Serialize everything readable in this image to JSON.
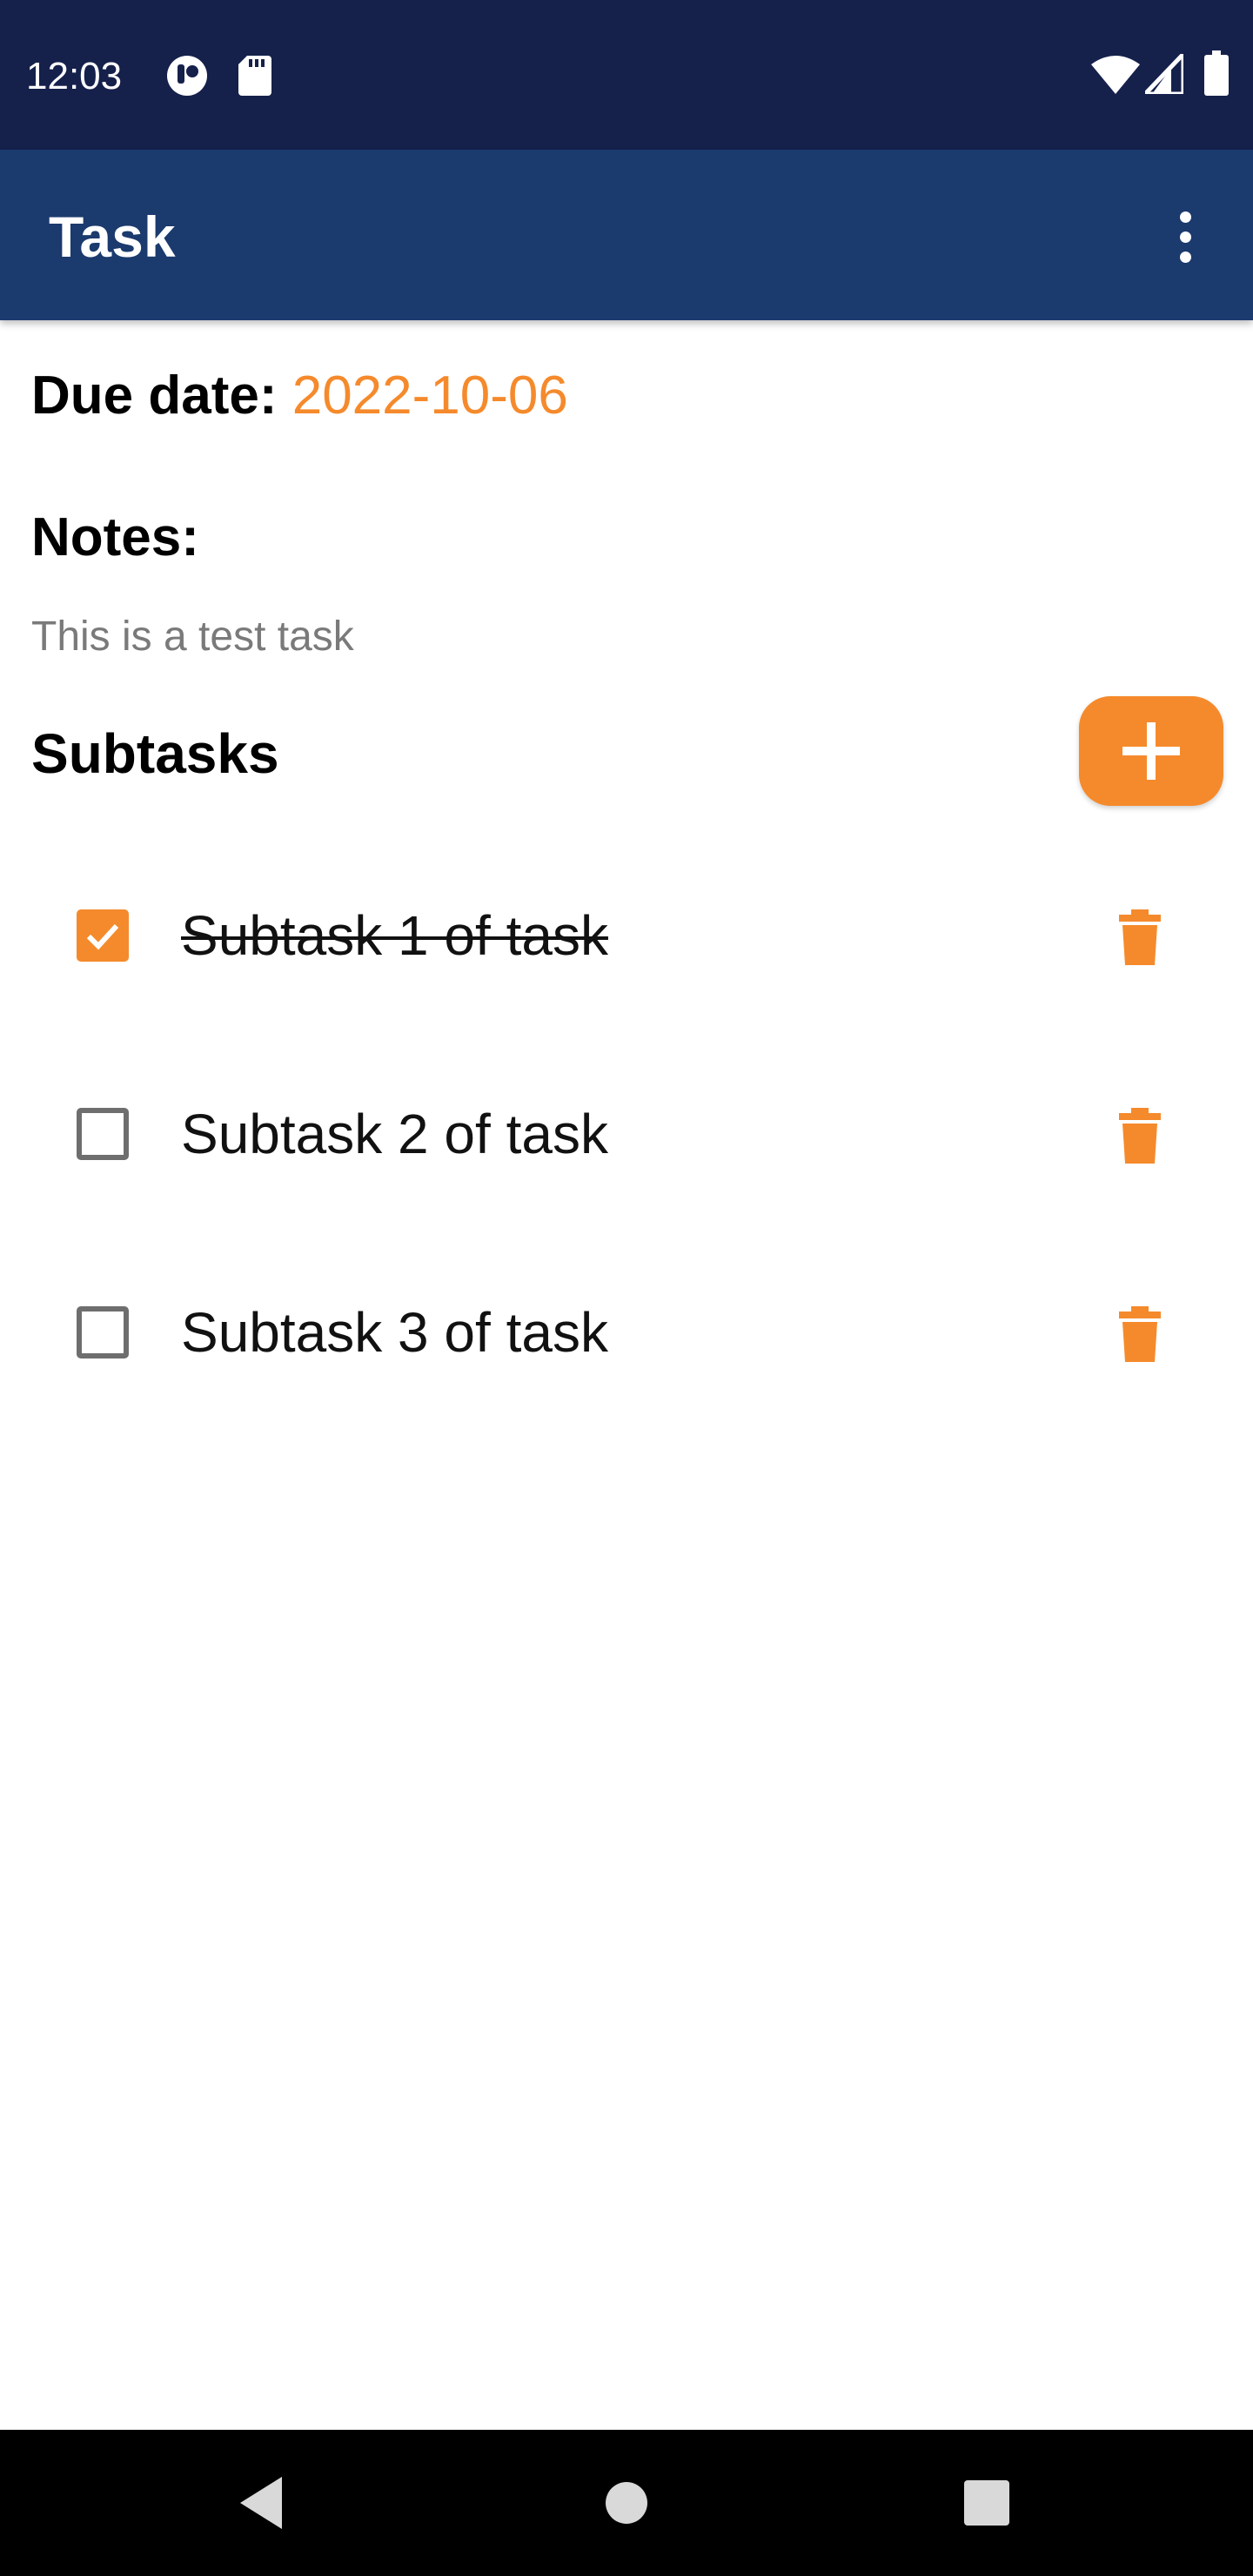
{
  "status_bar": {
    "time": "12:03",
    "left_icons": [
      "circle-status-icon",
      "sd-card-icon"
    ],
    "right_icons": [
      "wifi-icon",
      "signal-icon",
      "battery-icon"
    ]
  },
  "app_bar": {
    "title": "Task",
    "menu_icon": "more-vertical-icon"
  },
  "task": {
    "due_label": "Due date:",
    "due_value": "2022-10-06",
    "notes_label": "Notes:",
    "notes_text": "This is a test task"
  },
  "subtasks": {
    "label": "Subtasks",
    "add_icon": "plus-icon",
    "items": [
      {
        "text": "Subtask 1 of task",
        "checked": true
      },
      {
        "text": "Subtask 2 of task",
        "checked": false
      },
      {
        "text": "Subtask 3 of task",
        "checked": false
      }
    ],
    "delete_icon": "trash-icon"
  },
  "nav_bar": {
    "icons": [
      "back-icon",
      "home-icon",
      "recents-icon"
    ]
  },
  "colors": {
    "status_bar": "#15214b",
    "app_bar": "#1b3a6e",
    "accent": "#f58a2c",
    "notes_text": "#7a7a7a",
    "nav_bar": "#000000"
  }
}
